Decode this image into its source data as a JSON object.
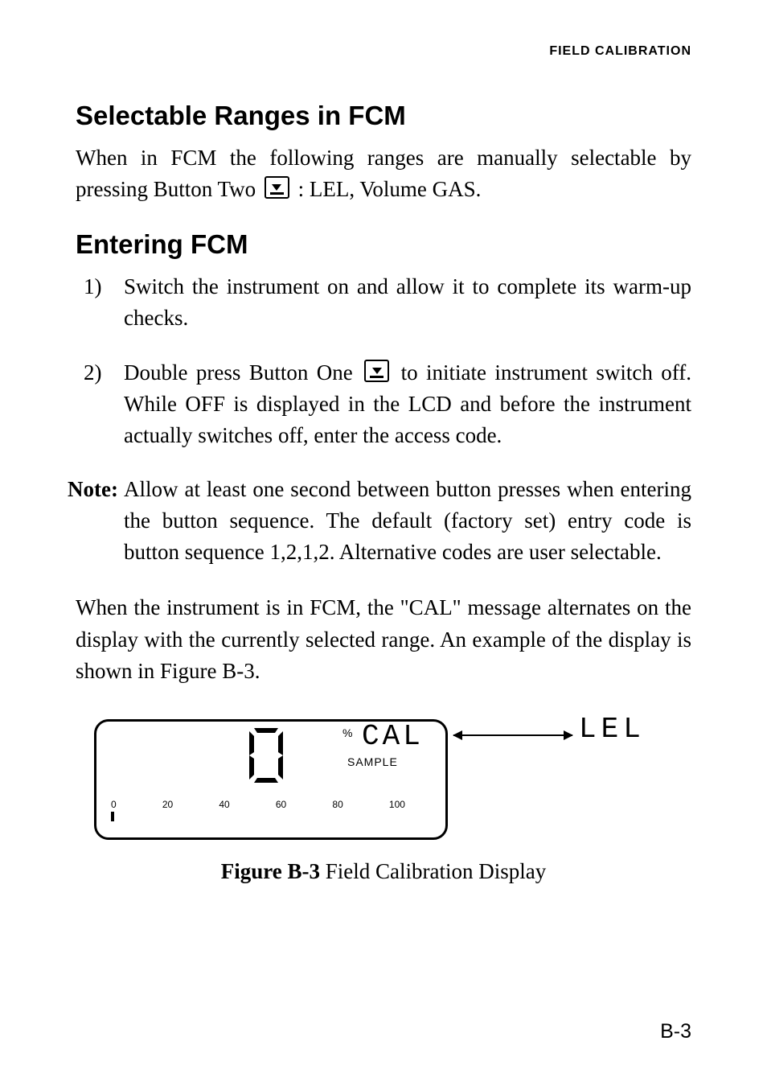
{
  "running_head": "FIELD CALIBRATION",
  "sections": {
    "ranges": {
      "heading": "Selectable Ranges in FCM",
      "body_pre": "When in FCM the following ranges are manually selectable by pressing Button Two ",
      "body_post": " : LEL, Volume GAS."
    },
    "entering": {
      "heading": "Entering FCM",
      "step1_num": "1)",
      "step1": "Switch the instrument on and allow it to complete its warm-up checks.",
      "step2_num": "2)",
      "step2_pre": "Double press Button One ",
      "step2_post": " to initiate instrument switch off. While OFF is displayed in the LCD and before the instrument actually switches off, enter the access code.",
      "note_label": "Note:",
      "note": "Allow at least one second between button presses when entering the button sequence. The default (factory set) entry code is button sequence 1,2,1,2. Alternative codes are user selectable.",
      "after": "When the instrument is in FCM, the \"CAL\" message alternates on the display with the currently selected range. An example of the display is shown in Figure B-3."
    }
  },
  "lcd": {
    "pct": "%",
    "cal": "CAL",
    "sample": "SAMPLE",
    "lel": "LEL",
    "scale": [
      "0",
      "20",
      "40",
      "60",
      "80",
      "100"
    ]
  },
  "figure": {
    "label": "Figure B-3",
    "caption": "  Field Calibration Display"
  },
  "page_number": "B-3",
  "icons": {
    "button_one": "button-one-icon",
    "button_two": "button-two-icon"
  }
}
